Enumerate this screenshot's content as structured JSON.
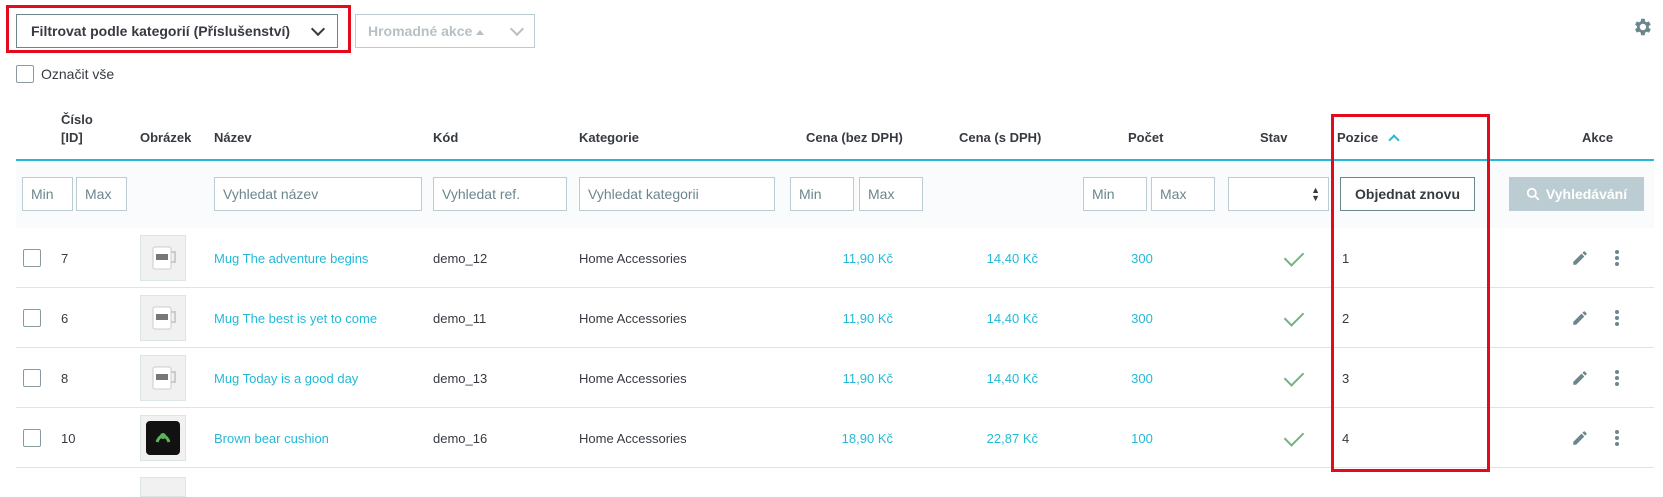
{
  "toolbar": {
    "filter_label": "Filtrovat podle kategorií (Příslušenství)",
    "bulk_label": "Hromadné akce",
    "select_all_label": "Označit vše"
  },
  "columns": {
    "id": "Číslo",
    "id2": "[ID]",
    "image": "Obrázek",
    "name": "Název",
    "code": "Kód",
    "category": "Kategorie",
    "price_ex": "Cena (bez DPH)",
    "price_inc": "Cena (s DPH)",
    "qty": "Počet",
    "status": "Stav",
    "position": "Pozice",
    "actions": "Akce"
  },
  "filters": {
    "id_min": "Min",
    "id_max": "Max",
    "name": "Vyhledat název",
    "ref": "Vyhledat ref.",
    "category": "Vyhledat kategorii",
    "price_min": "Min",
    "price_max": "Max",
    "qty_min": "Min",
    "qty_max": "Max",
    "reorder": "Objednat znovu",
    "search": "Vyhledávání"
  },
  "rows": [
    {
      "id": "7",
      "name": "Mug The adventure begins",
      "code": "demo_12",
      "category": "Home Accessories",
      "price_ex": "11,90 Kč",
      "price_inc": "14,40 Kč",
      "qty": "300",
      "position": "1"
    },
    {
      "id": "6",
      "name": "Mug The best is yet to come",
      "code": "demo_11",
      "category": "Home Accessories",
      "price_ex": "11,90 Kč",
      "price_inc": "14,40 Kč",
      "qty": "300",
      "position": "2"
    },
    {
      "id": "8",
      "name": "Mug Today is a good day",
      "code": "demo_13",
      "category": "Home Accessories",
      "price_ex": "11,90 Kč",
      "price_inc": "14,40 Kč",
      "qty": "300",
      "position": "3"
    },
    {
      "id": "10",
      "name": "Brown bear cushion",
      "code": "demo_16",
      "category": "Home Accessories",
      "price_ex": "18,90 Kč",
      "price_inc": "22,87 Kč",
      "qty": "100",
      "position": "4"
    }
  ],
  "colors": {
    "accent": "#25b9d7",
    "highlight": "#e40a1e",
    "status_ok": "#70b580"
  }
}
